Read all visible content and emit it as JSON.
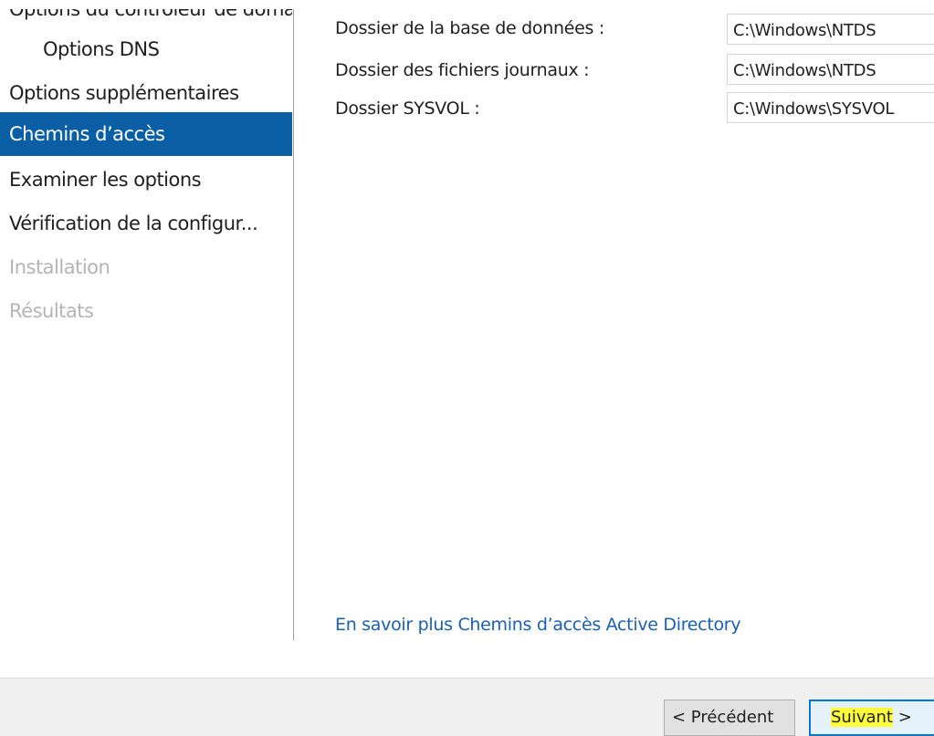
{
  "sidebar": {
    "items": [
      {
        "label": "Options du contrôleur de domaine",
        "state": "partial"
      },
      {
        "label": "Options DNS",
        "state": "sub"
      },
      {
        "label": "Options supplémentaires",
        "state": "normal"
      },
      {
        "label": "Chemins d’accès",
        "state": "selected"
      },
      {
        "label": "Examiner les options",
        "state": "normal"
      },
      {
        "label": "Vérification de la configur...",
        "state": "normal"
      },
      {
        "label": "Installation",
        "state": "disabled"
      },
      {
        "label": "Résultats",
        "state": "disabled"
      }
    ]
  },
  "paths": [
    {
      "label": "Dossier de la base de données :",
      "value": "C:\\Windows\\NTDS"
    },
    {
      "label": "Dossier des fichiers journaux :",
      "value": "C:\\Windows\\NTDS"
    },
    {
      "label": "Dossier SYSVOL :",
      "value": "C:\\Windows\\SYSVOL"
    }
  ],
  "learn_more_link": "En savoir plus Chemins d’accès Active Directory",
  "footer": {
    "prev_label": "< Précédent",
    "next_label_highlighted": "Suivant",
    "next_label_suffix": " >"
  },
  "colors": {
    "selected_bg": "#0a5fa4",
    "link": "#1a5fb4",
    "highlight": "#ffff3a",
    "disabled_text": "#b4b4b4"
  }
}
